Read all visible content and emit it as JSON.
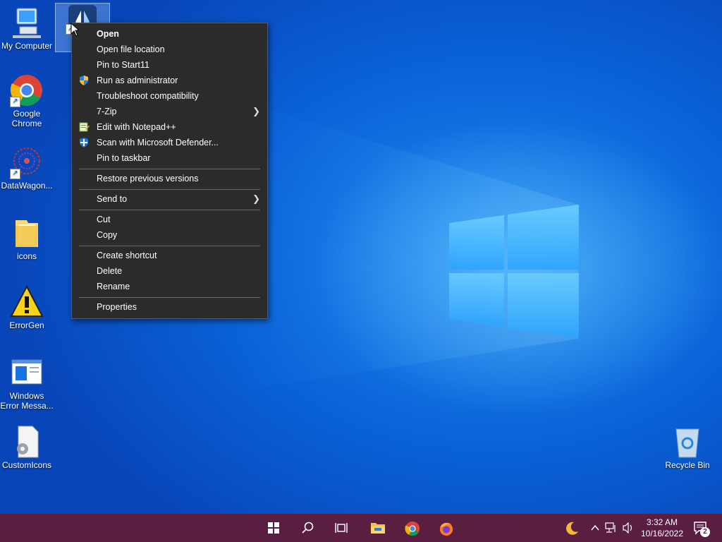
{
  "desktop": {
    "icons": [
      {
        "label": "My Computer"
      },
      {
        "label": ""
      },
      {
        "label": "Google Chrome"
      },
      {
        "label": "DataWagon..."
      },
      {
        "label": "icons"
      },
      {
        "label": "ErrorGen"
      },
      {
        "label": "Windows Error Messa..."
      },
      {
        "label": "CustomIcons"
      },
      {
        "label": "Recycle Bin"
      }
    ]
  },
  "context_menu": {
    "items": [
      {
        "label": "Open"
      },
      {
        "label": "Open file location"
      },
      {
        "label": "Pin to Start11"
      },
      {
        "label": "Run as administrator",
        "icon": "uac-shield-icon"
      },
      {
        "label": "Troubleshoot compatibility"
      },
      {
        "label": "7-Zip"
      },
      {
        "label": "Edit with Notepad++",
        "icon": "notepadpp-icon"
      },
      {
        "label": "Scan with Microsoft Defender...",
        "icon": "defender-shield-icon"
      },
      {
        "label": "Pin to taskbar"
      },
      {
        "label": "Restore previous versions"
      },
      {
        "label": "Send to"
      },
      {
        "label": "Cut"
      },
      {
        "label": "Copy"
      },
      {
        "label": "Create shortcut"
      },
      {
        "label": "Delete"
      },
      {
        "label": "Rename"
      },
      {
        "label": "Properties"
      }
    ]
  },
  "taskbar": {
    "icons": [
      "windows-start-icon",
      "search-icon",
      "task-view-icon",
      "file-explorer-icon",
      "chrome-icon",
      "firefox-icon",
      "moon-icon",
      "chevron-up-icon",
      "network-icon",
      "volume-icon",
      "notifications-icon"
    ],
    "clock_time": "3:32 AM",
    "clock_date": "10/16/2022",
    "notification_count": "2"
  },
  "colors": {
    "taskbar": "#5a1e41",
    "menu_bg": "#2b2b2b",
    "wallpaper": "#0a62d8"
  }
}
